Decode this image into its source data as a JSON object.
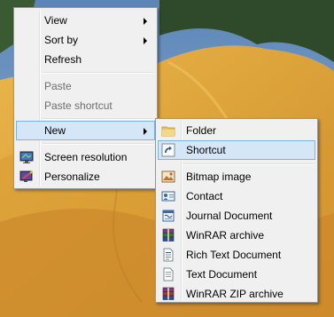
{
  "context_menu": {
    "items": [
      {
        "label": "View",
        "has_submenu": true
      },
      {
        "label": "Sort by",
        "has_submenu": true
      },
      {
        "label": "Refresh"
      },
      {
        "label": "Paste",
        "disabled": true
      },
      {
        "label": "Paste shortcut",
        "disabled": true
      },
      {
        "label": "New",
        "has_submenu": true,
        "highlighted": true
      },
      {
        "label": "Screen resolution",
        "icon": "screen-resolution-icon"
      },
      {
        "label": "Personalize",
        "icon": "personalize-icon"
      }
    ]
  },
  "new_submenu": {
    "items": [
      {
        "label": "Folder",
        "icon": "folder-icon"
      },
      {
        "label": "Shortcut",
        "icon": "shortcut-icon",
        "highlighted": true
      },
      {
        "label": "Bitmap image",
        "icon": "bitmap-image-icon"
      },
      {
        "label": "Contact",
        "icon": "contact-icon"
      },
      {
        "label": "Journal Document",
        "icon": "journal-document-icon"
      },
      {
        "label": "WinRAR archive",
        "icon": "winrar-archive-icon"
      },
      {
        "label": "Rich Text Document",
        "icon": "rich-text-document-icon"
      },
      {
        "label": "Text Document",
        "icon": "text-document-icon"
      },
      {
        "label": "WinRAR ZIP archive",
        "icon": "winrar-zip-archive-icon"
      }
    ]
  },
  "colors": {
    "highlight_bg": "#d5e6f7",
    "highlight_border": "#7ab3ea",
    "menu_bg": "#f0f0f0",
    "disabled_text": "#6d6d6d"
  }
}
